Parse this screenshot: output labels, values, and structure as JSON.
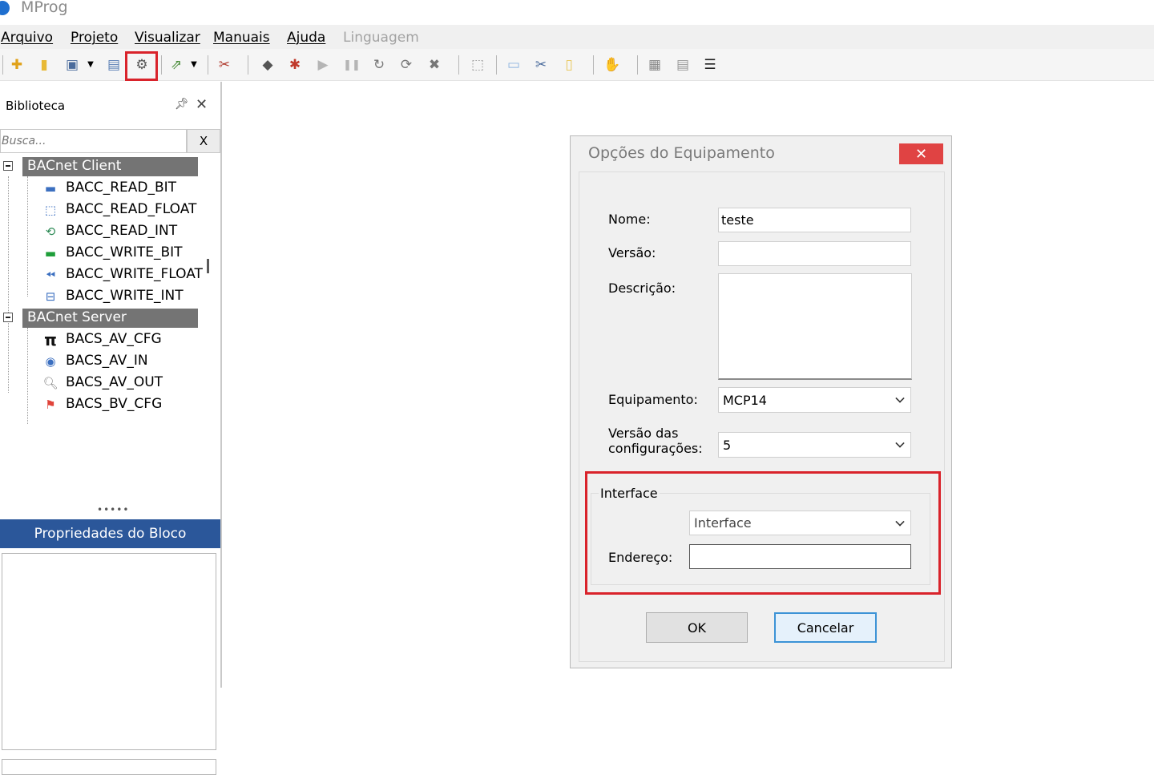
{
  "app": {
    "title": "MProg"
  },
  "menu": {
    "items": [
      {
        "label": "Arquivo",
        "enabled": true
      },
      {
        "label": "Projeto",
        "enabled": true
      },
      {
        "label": "Visualizar",
        "enabled": true
      },
      {
        "label": "Manuais",
        "enabled": true
      },
      {
        "label": "Ajuda",
        "enabled": true
      },
      {
        "label": "Linguagem",
        "enabled": false
      }
    ]
  },
  "toolbar": {
    "icons": [
      "new-icon",
      "open-icon",
      "save-icon",
      "save-dropdown-icon",
      "print-icon",
      "settings-icon",
      "export-icon",
      "export-dropdown-icon",
      "tools-icon",
      "debug-icon",
      "bug-icon",
      "run-icon",
      "pause-icon",
      "step-icon",
      "refresh-icon",
      "stop-icon",
      "select-icon",
      "copy-icon",
      "cut-icon",
      "paste-icon",
      "hand-icon",
      "grid-icon",
      "page-icon",
      "list-icon"
    ],
    "highlighted": "settings-icon"
  },
  "library": {
    "title": "Biblioteca",
    "search_placeholder": "Busca...",
    "search_clear_label": "X",
    "groups": [
      {
        "label": "BACnet Client",
        "items": [
          {
            "label": "BACC_READ_BIT",
            "icon": "bar-icon"
          },
          {
            "label": "BACC_READ_FLOAT",
            "icon": "chart-icon"
          },
          {
            "label": "BACC_READ_INT",
            "icon": "doc-refresh-icon"
          },
          {
            "label": "BACC_WRITE_BIT",
            "icon": "green-bar-icon"
          },
          {
            "label": "BACC_WRITE_FLOAT",
            "icon": "rewind-icon"
          },
          {
            "label": "BACC_WRITE_INT",
            "icon": "split-box-icon"
          }
        ]
      },
      {
        "label": "BACnet Server",
        "items": [
          {
            "label": "BACS_AV_CFG",
            "icon": "pi-icon"
          },
          {
            "label": "BACS_AV_IN",
            "icon": "signal-icon"
          },
          {
            "label": "BACS_AV_OUT",
            "icon": "magnifier-icon"
          },
          {
            "label": "BACS_BV_CFG",
            "icon": "flag-icon"
          }
        ]
      }
    ]
  },
  "properties": {
    "title": "Propriedades do Bloco"
  },
  "dialog": {
    "title": "Opções do Equipamento",
    "close_label": "✕",
    "fields": {
      "nome_label": "Nome:",
      "nome_value": "teste",
      "versao_label": "Versão:",
      "versao_value": "",
      "descricao_label": "Descrição:",
      "descricao_value": "",
      "equipamento_label": "Equipamento:",
      "equipamento_value": "MCP14",
      "versao_config_label_line1": "Versão das",
      "versao_config_label_line2": "configurações:",
      "versao_config_value": "5"
    },
    "interface_group": {
      "legend": "Interface",
      "select_value": "Interface",
      "endereco_label": "Endereço:",
      "endereco_value": ""
    },
    "ok_label": "OK",
    "cancel_label": "Cancelar",
    "highlight_color": "#d9232b"
  }
}
